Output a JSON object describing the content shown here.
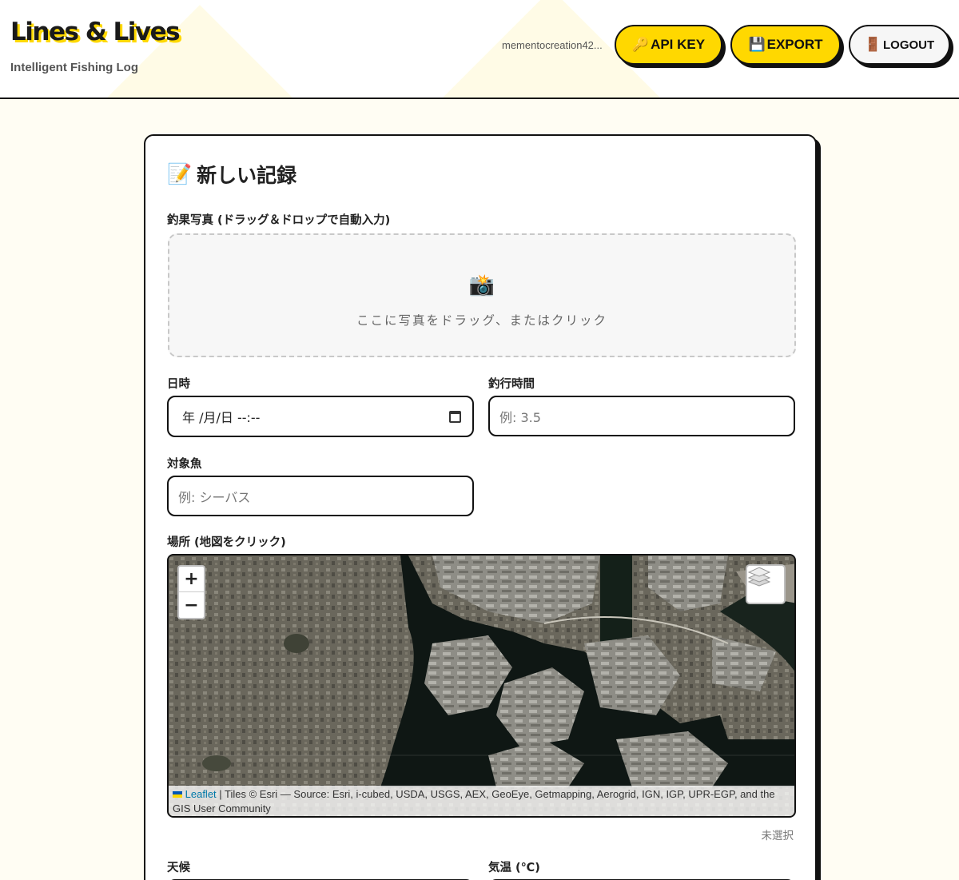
{
  "header": {
    "logo": "Lines & Lives",
    "tagline": "Intelligent Fishing Log",
    "user_email": "mementocreation42...",
    "buttons": {
      "api_key": "API KEY",
      "export": "EXPORT",
      "logout": "LOGOUT"
    },
    "icons": {
      "api_key": "🔑",
      "export": "💾",
      "logout": "🚪"
    }
  },
  "form": {
    "title": "新しい記録",
    "title_icon": "📝",
    "photo": {
      "label": "釣果写真 (ドラッグ＆ドロップで自動入力)",
      "icon": "📸",
      "dropzone_text": "ここに写真をドラッグ、またはクリック"
    },
    "datetime": {
      "label": "日時",
      "value": "年 /月/日  --:--"
    },
    "duration": {
      "label": "釣行時間",
      "placeholder": "例: 3.5"
    },
    "species": {
      "label": "対象魚",
      "placeholder": "例: シーバス"
    },
    "location": {
      "label": "場所 (地図をクリック)",
      "status": "未選択"
    },
    "map": {
      "zoom_in": "+",
      "zoom_out": "−",
      "attribution_link": "Leaflet",
      "attribution_text": " | Tiles © Esri — Source: Esri, i-cubed, USDA, USGS, AEX, GeoEye, Getmapping, Aerogrid, IGN, IGP, UPR-EGP, and the GIS User Community"
    },
    "weather": {
      "label": "天候"
    },
    "temperature": {
      "label": "気温 (℃)"
    }
  },
  "colors": {
    "accent": "#ffd800",
    "background": "#fffdf3",
    "border": "#111111"
  }
}
